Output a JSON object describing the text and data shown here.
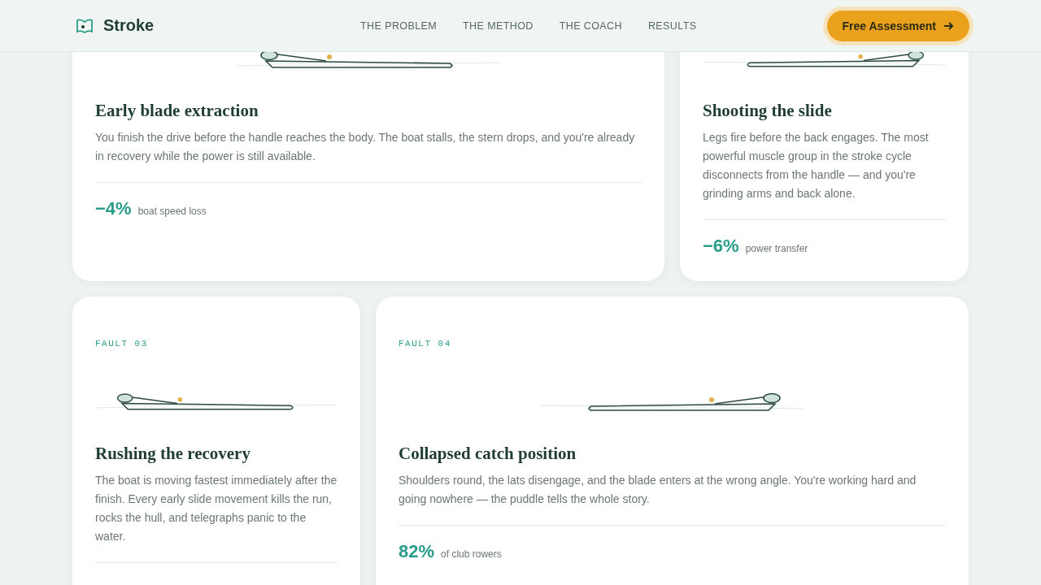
{
  "header": {
    "brand": "Stroke",
    "nav": [
      {
        "label": "THE PROBLEM"
      },
      {
        "label": "THE METHOD"
      },
      {
        "label": "THE COACH"
      },
      {
        "label": "RESULTS"
      }
    ],
    "cta": "Free Assessment"
  },
  "rows": [
    {
      "cards": [
        {
          "mirrored": false,
          "title": "Early blade extraction",
          "text": "You finish the drive before the handle reaches the body. The boat stalls, the stern drops, and you're already in recovery while the power is still available.",
          "stat_value": "−4%",
          "stat_label": "boat speed loss"
        },
        {
          "mirrored": true,
          "title": "Shooting the slide",
          "text": "Legs fire before the back engages. The most powerful muscle group in the stroke cycle disconnects from the handle — and you're grinding arms and back alone.",
          "stat_value": "−6%",
          "stat_label": "power transfer"
        }
      ]
    },
    {
      "cards": [
        {
          "label": "FAULT 03",
          "mirrored": false,
          "title": "Rushing the recovery",
          "text": "The boat is moving fastest immediately after the finish. Every early slide movement kills the run, rocks the hull, and telegraphs panic to the water."
        },
        {
          "label": "FAULT 04",
          "mirrored": true,
          "title": "Collapsed catch position",
          "text": "Shoulders round, the lats disengage, and the blade enters at the wrong angle. You're working hard and going nowhere — the puddle tells the whole story.",
          "stat_value": "82%",
          "stat_label": "of club rowers"
        }
      ]
    }
  ]
}
